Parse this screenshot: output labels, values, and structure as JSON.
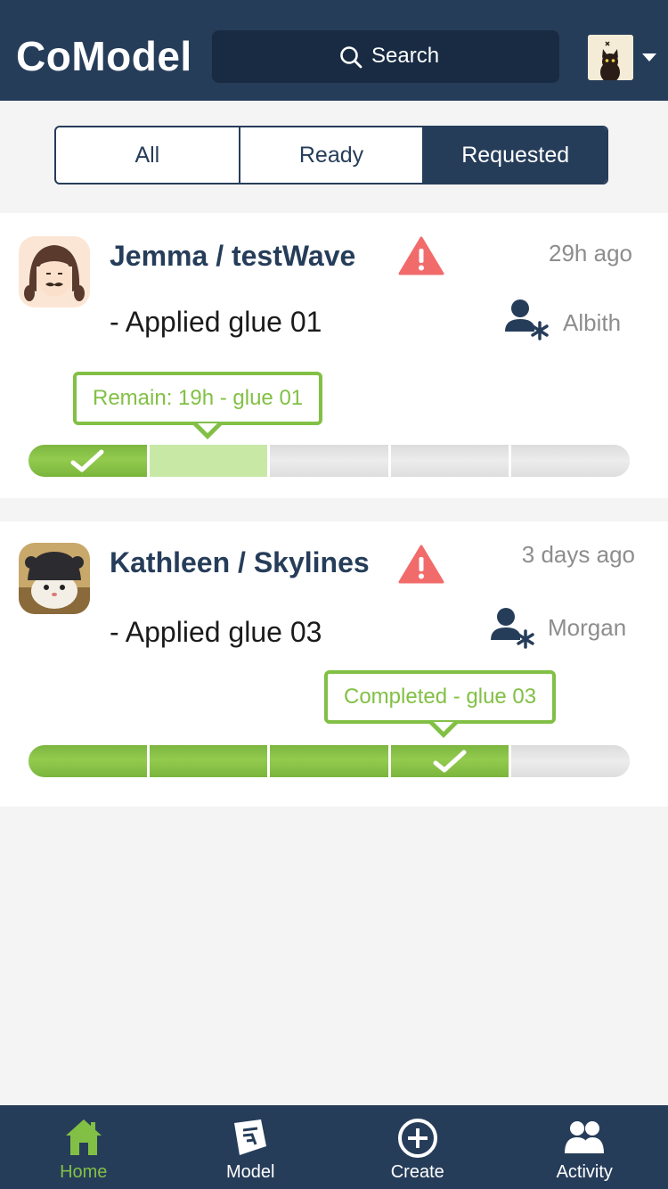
{
  "header": {
    "title": "CoModel",
    "search_label": "Search"
  },
  "filters": {
    "tabs": [
      {
        "label": "All",
        "active": false
      },
      {
        "label": "Ready",
        "active": false
      },
      {
        "label": "Requested",
        "active": true
      }
    ]
  },
  "cards": [
    {
      "title": "Jemma / testWave",
      "time": "29h ago",
      "description": "- Applied glue 01",
      "assignee": "Albith",
      "status_icon": "warning-icon",
      "progress": {
        "total_steps": 5,
        "completed_steps": 1,
        "current_step": 2,
        "bubble": "Remain: 19h - glue 01"
      }
    },
    {
      "title": "Kathleen / Skylines",
      "time": "3 days ago",
      "description": "- Applied glue 03",
      "assignee": "Morgan",
      "status_icon": "warning-icon",
      "progress": {
        "total_steps": 5,
        "completed_steps": 4,
        "current_step": 4,
        "bubble": "Completed - glue 03"
      }
    }
  ],
  "nav": {
    "items": [
      {
        "label": "Home",
        "icon": "home-icon",
        "active": true
      },
      {
        "label": "Model",
        "icon": "model-icon",
        "active": false
      },
      {
        "label": "Create",
        "icon": "plus-circle-icon",
        "active": false
      },
      {
        "label": "Activity",
        "icon": "users-icon",
        "active": false
      }
    ]
  },
  "colors": {
    "primary": "#263d5a",
    "accent_green": "#82c045",
    "warning": "#f26b6b"
  }
}
